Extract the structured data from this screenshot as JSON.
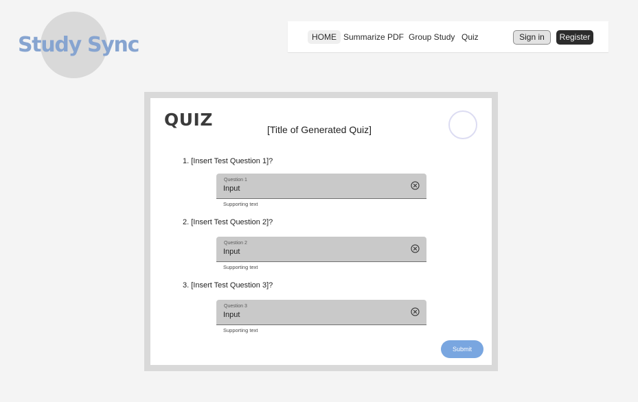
{
  "logo": {
    "text": "Study Sync"
  },
  "nav": {
    "items": [
      {
        "label": "HOME"
      },
      {
        "label": "Summarize PDF"
      },
      {
        "label": "Group Study"
      },
      {
        "label": "Quiz"
      }
    ],
    "signin_label": "Sign in",
    "register_label": "Register"
  },
  "quiz": {
    "heading": "QUIZ",
    "title": "[Title of Generated Quiz]",
    "questions": [
      {
        "text": "1. [Insert Test Question 1]?",
        "field_label": "Question 1",
        "input_value": "Input",
        "supporting_text": "Supporting text"
      },
      {
        "text": "2. [Insert Test Question 2]?",
        "field_label": "Question 2",
        "input_value": "Input",
        "supporting_text": "Supporting text"
      },
      {
        "text": "3. [Insert Test Question 3]?",
        "field_label": "Question 3",
        "input_value": "Input",
        "supporting_text": "Supporting text"
      }
    ],
    "submit_label": "Submit"
  },
  "icons": {
    "clear": "close-circle-icon",
    "timer": "timer-ring-icon"
  },
  "colors": {
    "logo_text": "#86a4d0",
    "submit_button": "#79a6e0",
    "register_button": "#2c2c2c"
  }
}
